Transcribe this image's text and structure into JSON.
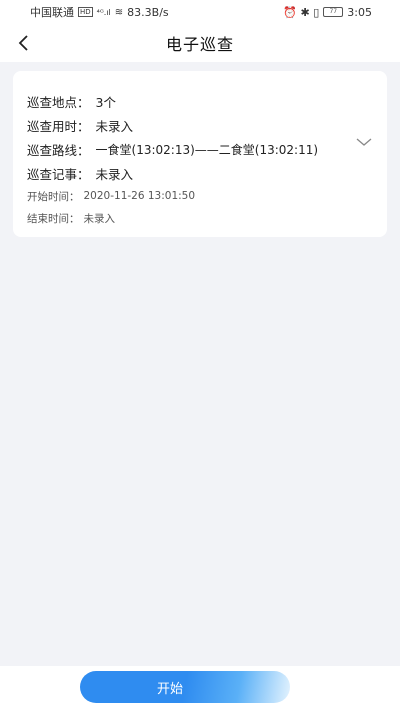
{
  "status_bar": {
    "carrier": "中国联通",
    "hd": "HD",
    "signal": "⁴ᴳ.ıl",
    "wifi": "≋",
    "speed": "83.3B/s",
    "right_icons": "⏰ ✱ ▯",
    "battery": "77",
    "time": "3:05"
  },
  "nav": {
    "title": "电子巡查"
  },
  "info": {
    "location_label": "巡查地点：",
    "location_value": "3个",
    "duration_label": "巡查用时：",
    "duration_value": "未录入",
    "route_label": "巡查路线：",
    "route_value": "一食堂(13:02:13)——二食堂(13:02:11)",
    "note_label": "巡查记事：",
    "note_value": "未录入",
    "start_label": "开始时间：",
    "start_value": "2020-11-26 13:01:50",
    "end_label": "结束时间：",
    "end_value": "未录入"
  },
  "button": {
    "label": "开始"
  },
  "colors": {
    "accent": "#2f8cf0",
    "background": "#f2f3f7",
    "card": "#ffffff"
  }
}
